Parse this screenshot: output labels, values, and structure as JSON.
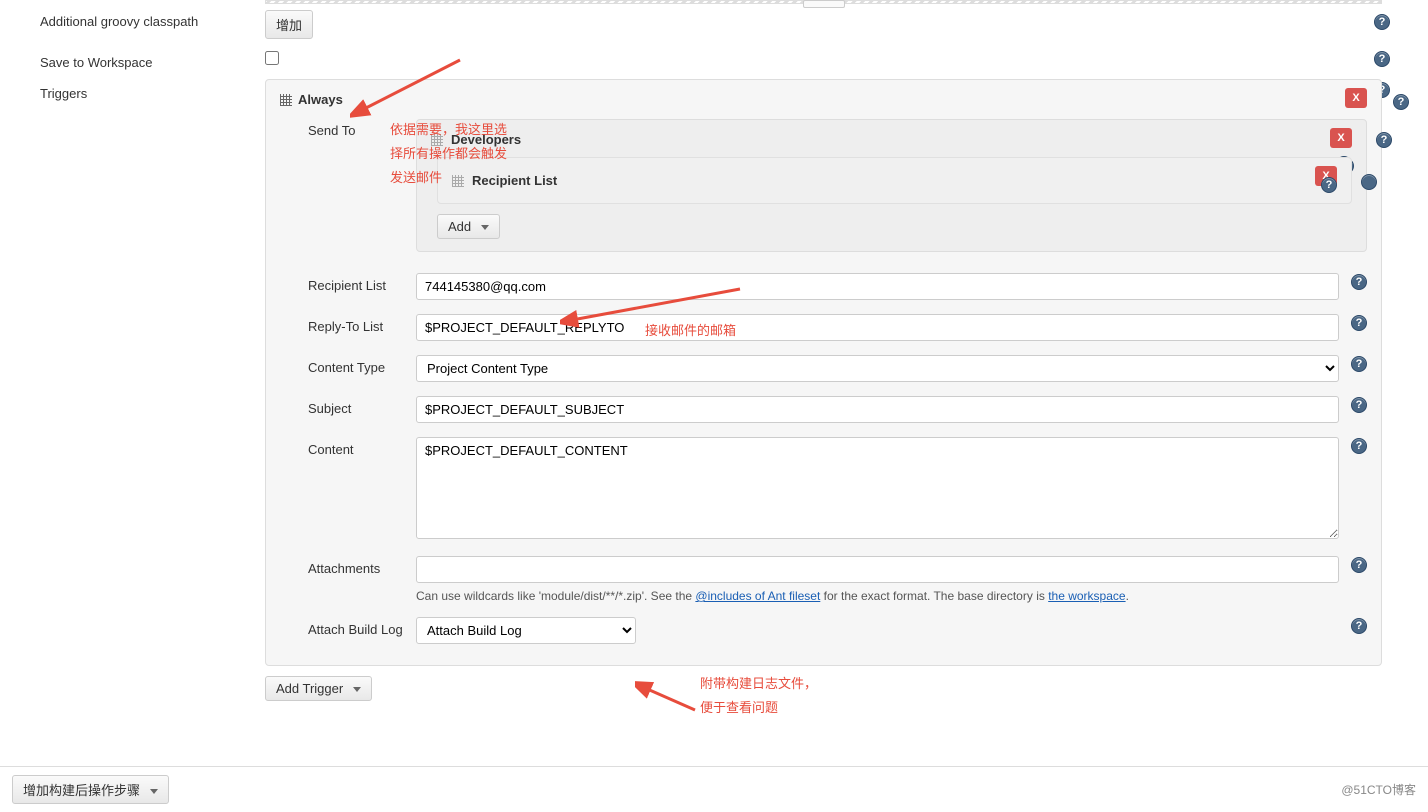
{
  "labels": {
    "additional_groovy": "Additional groovy classpath",
    "save_to_workspace": "Save to Workspace",
    "triggers": "Triggers"
  },
  "buttons": {
    "add_cn": "增加",
    "add": "Add",
    "add_trigger": "Add Trigger",
    "add_postbuild": "增加构建后操作步骤",
    "remove": "X"
  },
  "panel": {
    "always": "Always",
    "send_to": "Send To",
    "developers": "Developers",
    "recipient_list_title": "Recipient List"
  },
  "form": {
    "recipient_list_label": "Recipient List",
    "recipient_list_value": "744145380@qq.com",
    "reply_to_label": "Reply-To List",
    "reply_to_value": "$PROJECT_DEFAULT_REPLYTO",
    "content_type_label": "Content Type",
    "content_type_value": "Project Content Type",
    "subject_label": "Subject",
    "subject_value": "$PROJECT_DEFAULT_SUBJECT",
    "content_label": "Content",
    "content_value": "$PROJECT_DEFAULT_CONTENT",
    "attachments_label": "Attachments",
    "attachments_value": "",
    "attachments_hint_pre": "Can use wildcards like 'module/dist/**/*.zip'. See the ",
    "attachments_hint_link1": "@includes of Ant fileset",
    "attachments_hint_mid": " for the exact format. The base directory is ",
    "attachments_hint_link2": "the workspace",
    "attach_build_log_label": "Attach Build Log",
    "attach_build_log_value": "Attach Build Log"
  },
  "annotations": {
    "anno1_line1": "依据需要，我这里选",
    "anno1_line2": "择所有操作都会触发",
    "anno1_line3": "发送邮件",
    "anno2": "接收邮件的邮箱",
    "anno3_line1": "附带构建日志文件，",
    "anno3_line2": "便于查看问题"
  },
  "watermark": "@51CTO博客"
}
